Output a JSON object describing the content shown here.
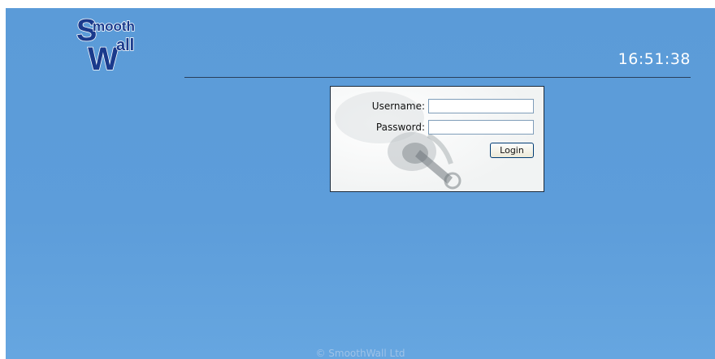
{
  "logo": {
    "line1": "Smooth",
    "line2": "Wall"
  },
  "clock": {
    "time": "16:51:38"
  },
  "login": {
    "username_label": "Username:",
    "password_label": "Password:",
    "username_value": "",
    "password_value": "",
    "button_label": "Login"
  },
  "footer": {
    "copyright": "© SmoothWall Ltd"
  },
  "colors": {
    "background": "#5b9bd8",
    "panel": "#f4f6f6",
    "rule": "#2a3f5a"
  }
}
